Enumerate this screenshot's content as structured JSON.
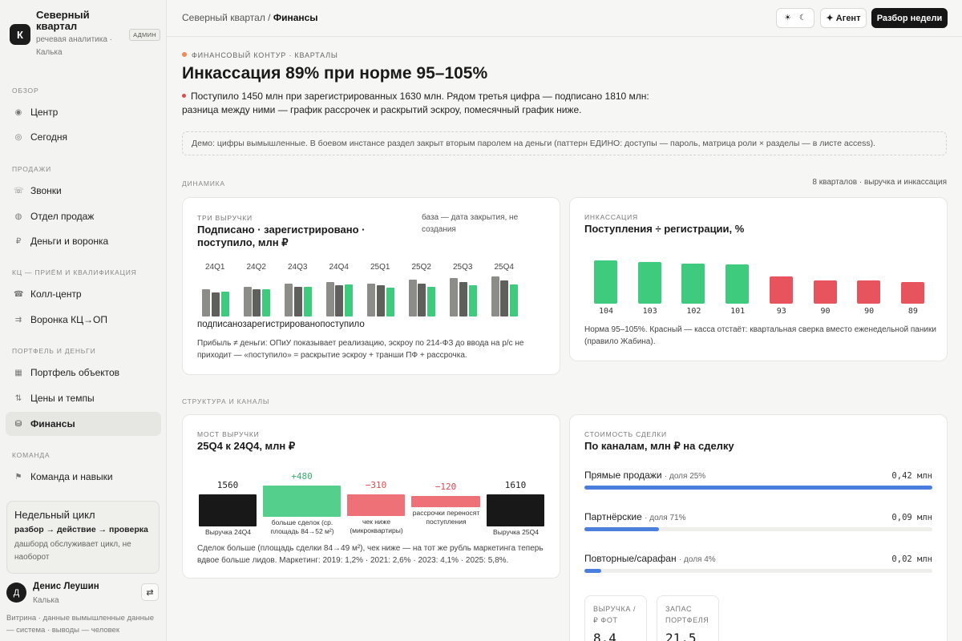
{
  "brand": {
    "logo": "К",
    "name": "Северный квартал",
    "sub": "речевая аналитика · Калька",
    "badge": "АДМИН"
  },
  "nav": {
    "sections": [
      {
        "title": "ОБЗОР"
      },
      {
        "title": "ПРОДАЖИ"
      },
      {
        "title": "КЦ — ПРИЁМ И КВАЛИФИКАЦИЯ"
      },
      {
        "title": "ПОРТФЕЛЬ И ДЕНЬГИ"
      },
      {
        "title": "КОМАНДА"
      }
    ],
    "items": [
      {
        "label": "Центр",
        "icon": "target-icon",
        "glyph": "◉"
      },
      {
        "label": "Сегодня",
        "icon": "circle-icon",
        "glyph": "◎"
      },
      {
        "label": "Звонки",
        "icon": "calls-icon",
        "glyph": "☏"
      },
      {
        "label": "Отдел продаж",
        "icon": "team-icon",
        "glyph": "◍"
      },
      {
        "label": "Деньги и воронка",
        "icon": "ruble-icon",
        "glyph": "₽"
      },
      {
        "label": "Колл-центр",
        "icon": "phone-icon",
        "glyph": "☎"
      },
      {
        "label": "Воронка КЦ→ОП",
        "icon": "funnel-icon",
        "glyph": "⇉"
      },
      {
        "label": "Портфель объектов",
        "icon": "grid-icon",
        "glyph": "▦"
      },
      {
        "label": "Цены и темпы",
        "icon": "sort-icon",
        "glyph": "⇅"
      },
      {
        "label": "Финансы",
        "icon": "database-icon",
        "glyph": "⛁"
      },
      {
        "label": "Команда и навыки",
        "icon": "flag-icon",
        "glyph": "⚑"
      }
    ]
  },
  "cycle": {
    "title": "Недельный цикл",
    "flow": "разбор → действие → проверка",
    "note": "дашборд обслуживает цикл, не наоборот"
  },
  "user": {
    "initial": "Д",
    "name": "Денис Леушин",
    "role": "Калька",
    "switch": "⇄"
  },
  "footer_note": "Витрина · данные вымышленные данные — система · выводы — человек",
  "topbar": {
    "crumb_parent": "Северный квартал /",
    "crumb_current": "Финансы",
    "theme_sun": "☀",
    "theme_moon": "☾",
    "agent": "✦ Агент",
    "review": "Разбор недели"
  },
  "header": {
    "eyebrow": "ФИНАНСОВЫЙ КОНТУР · КВАРТАЛЫ",
    "title": "Инкассация 89% при норме 95–105%",
    "lede": "Поступило 1450 млн при зарегистрированных 1630 млн. Рядом третья цифра — подписано 1810 млн: разница между ними — график рассрочек и раскрытий эскроу, помесячный график ниже.",
    "demo": "Демо: цифры вымышленные. В боевом инстансе раздел закрыт вторым паролем на деньги (паттерн ЕДИНО: доступы — пароль, матрица роли × разделы — в листе access)."
  },
  "sections": {
    "dynamics": "ДИНАМИКА",
    "dynamics_right": "8 кварталов · выручка и инкассация",
    "structure": "СТРУКТУРА И КАНАЛЫ"
  },
  "chart_data": [
    {
      "type": "bar",
      "eyebrow": "ТРИ ВЫРУЧКИ",
      "title": "Подписано · зарегистрировано · поступило, млн ₽",
      "side_note": "база — дата закрытия, не создания",
      "categories": [
        "24Q1",
        "24Q2",
        "24Q3",
        "24Q4",
        "25Q1",
        "25Q2",
        "25Q3",
        "25Q4"
      ],
      "series": [
        {
          "name": "подписано",
          "color": "#8c8c88",
          "values": [
            1220,
            1330,
            1480,
            1560,
            1500,
            1650,
            1730,
            1810
          ]
        },
        {
          "name": "зарегистрировано",
          "color": "#5f5f5b",
          "values": [
            1080,
            1220,
            1350,
            1400,
            1400,
            1470,
            1540,
            1630
          ]
        },
        {
          "name": "поступило",
          "color": "#3ecb7d",
          "values": [
            1130,
            1230,
            1330,
            1450,
            1310,
            1350,
            1400,
            1450
          ]
        }
      ],
      "ylim": [
        0,
        1900
      ],
      "note": "Прибыль ≠ деньги: ОПиУ показывает реализацию, эскроу по 214-ФЗ до ввода на р/с не приходит — «поступило» = раскрытие эскроу + транши ПФ + рассрочка."
    },
    {
      "type": "bar",
      "eyebrow": "ИНКАССАЦИЯ",
      "title": "Поступления ÷ регистрации, %",
      "values": [
        104,
        103,
        102,
        101,
        93,
        90,
        90,
        89
      ],
      "norm": [
        95,
        105
      ],
      "colors": {
        "ok": "#3ecb7d",
        "bad": "#e8545e"
      },
      "ylim": [
        0,
        110
      ],
      "note": "Норма 95–105%. Красный — касса отстаёт: квартальная сверка вместо еженедельной паники (правило Жабина)."
    },
    {
      "type": "bar",
      "subtype": "waterfall",
      "eyebrow": "МОСТ ВЫРУЧКИ",
      "title": "25Q4 к 24Q4, млн ₽",
      "steps": [
        {
          "label": "Выручка 24Q4",
          "value_label": "1560",
          "value": 1560,
          "kind": "total"
        },
        {
          "label": "больше сделок (ср. площадь 84→52 м²)",
          "value_label": "+480",
          "value": 480,
          "kind": "up"
        },
        {
          "label": "чек ниже (микроквартиры)",
          "value_label": "−310",
          "value": -310,
          "kind": "down"
        },
        {
          "label": "рассрочки переносят поступления",
          "value_label": "−120",
          "value": -120,
          "kind": "down"
        },
        {
          "label": "Выручка 25Q4",
          "value_label": "1610",
          "value": 1610,
          "kind": "total"
        }
      ],
      "note": "Сделок больше (площадь сделки 84→49 м²), чек ниже — на тот же рубль маркетинга теперь вдвое больше лидов. Маркетинг: 2019: 1,2% · 2021: 2,6% · 2023: 4,1% · 2025: 5,8%."
    },
    {
      "type": "bar",
      "subtype": "horizontal",
      "eyebrow": "СТОИМОСТЬ СДЕЛКИ",
      "title": "По каналам, млн ₽ на сделку",
      "categories": [
        "Прямые продажи",
        "Партнёрские",
        "Повторные/сарафан"
      ],
      "shares": [
        "· доля 25%",
        "· доля 71%",
        "· доля 4%"
      ],
      "values": [
        0.42,
        0.09,
        0.02
      ],
      "value_labels": [
        "0,42 млн",
        "0,09 млн",
        "0,02 млн"
      ],
      "xlim": [
        0,
        0.42
      ]
    }
  ],
  "kpis": [
    {
      "label": "ВЫРУЧКА / ₽ ФОТ",
      "value": "8,4"
    },
    {
      "label": "ЗАПАС ПОРТФЕЛЯ",
      "value": "21,5"
    }
  ]
}
